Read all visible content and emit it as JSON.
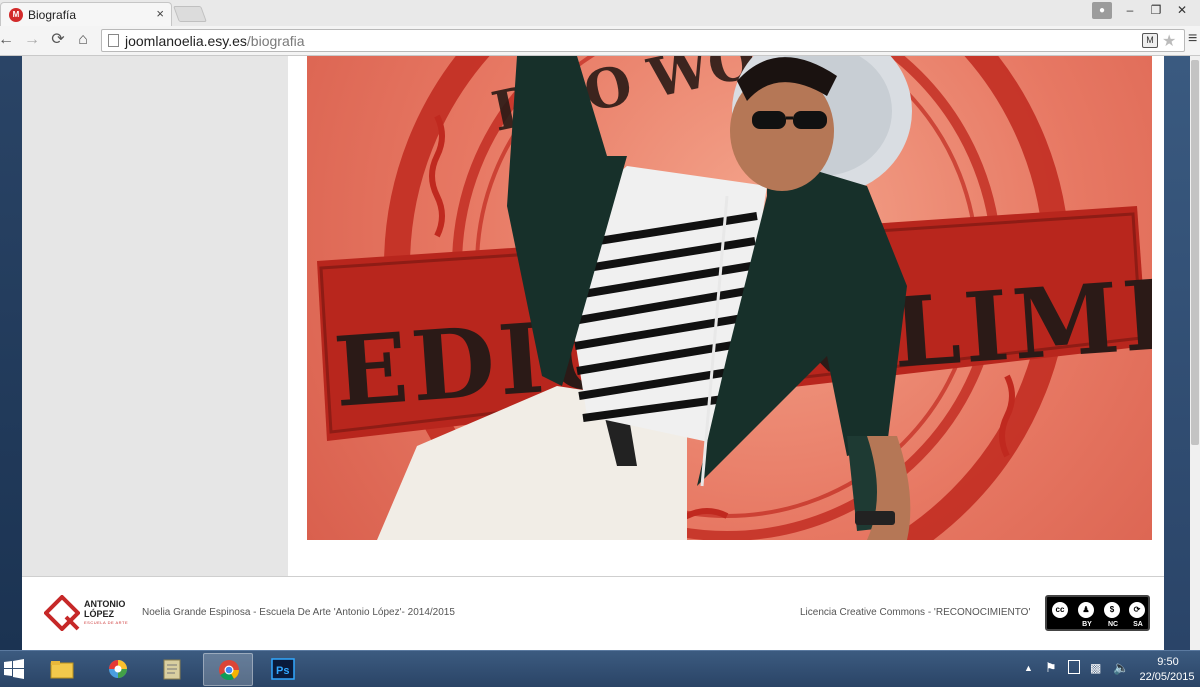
{
  "browser": {
    "tab_title": "Biografía",
    "favicon_text": "M",
    "tab_close": "×",
    "url_host": "joomlanoelia.esy.es",
    "url_path": "/biografia",
    "window_controls": {
      "minimize": "–",
      "maximize": "❐",
      "close": "✕"
    }
  },
  "nav": {
    "back": "←",
    "forward": "→",
    "reload": "⟳",
    "home": "⌂",
    "star": "★",
    "menu": "≡"
  },
  "photo": {
    "banner_text": "EDICIÓN LIMITADA",
    "stamp_text": "DOO WOPS",
    "colors": {
      "background": "#e77863",
      "stamp": "#c0291f",
      "jacket": "#17302a"
    }
  },
  "footer": {
    "logo_line1": "ANTONIO",
    "logo_line2": "LÓPEZ",
    "logo_sub": "ESCUELA DE ARTE",
    "credit": "Noelia Grande Espinosa - Escuela De Arte 'Antonio López'- 2014/2015",
    "license": "Licencia Creative Commons - 'RECONOCIMIENTO'",
    "cc_labels": [
      "BY",
      "NC",
      "SA"
    ]
  },
  "taskbar": {
    "apps": [
      "file-explorer",
      "internet-explorer",
      "notepad",
      "chrome",
      "photoshop"
    ],
    "ps_label": "Ps",
    "time": "9:50",
    "date": "22/05/2015"
  }
}
